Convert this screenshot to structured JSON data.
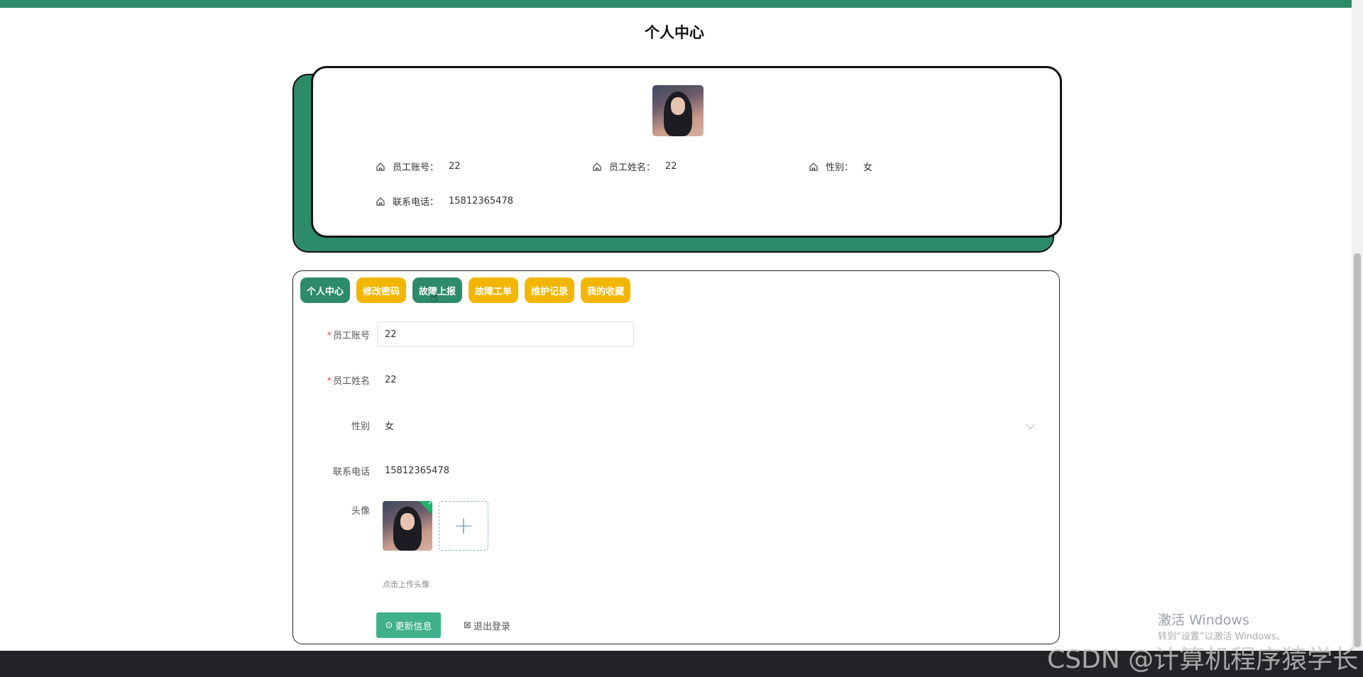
{
  "page": {
    "title": "个人中心",
    "accent_color": "#2e8b6a",
    "tab_yellow_color": "#f2b600"
  },
  "profile_card": {
    "avatar": "user-photo",
    "fields": [
      {
        "label": "员工账号：",
        "value": "22"
      },
      {
        "label": "员工姓名：",
        "value": "22"
      },
      {
        "label": "性别：",
        "value": "女"
      },
      {
        "label": "联系电话：",
        "value": "15812365478"
      }
    ]
  },
  "tabs": [
    {
      "label": "个人中心",
      "active": true
    },
    {
      "label": "修改密码",
      "active": false
    },
    {
      "label": "故障上报",
      "active": true
    },
    {
      "label": "故障工单",
      "active": false
    },
    {
      "label": "维护记录",
      "active": false
    },
    {
      "label": "我的收藏",
      "active": false
    }
  ],
  "form": {
    "account": {
      "label": "员工账号",
      "value": "22",
      "required": true
    },
    "name": {
      "label": "员工姓名",
      "value": "22",
      "required": true
    },
    "gender": {
      "label": "性别",
      "value": "女"
    },
    "phone": {
      "label": "联系电话",
      "value": "15812365478"
    },
    "avatar": {
      "label": "头像",
      "tip": "点击上传头像"
    },
    "update_button": "更新信息",
    "logout_button": "退出登录"
  },
  "os": {
    "activate_title": "激活 Windows",
    "activate_sub": "转到“设置”以激活 Windows。",
    "watermark": "CSDN @计算机程序猿学长"
  }
}
